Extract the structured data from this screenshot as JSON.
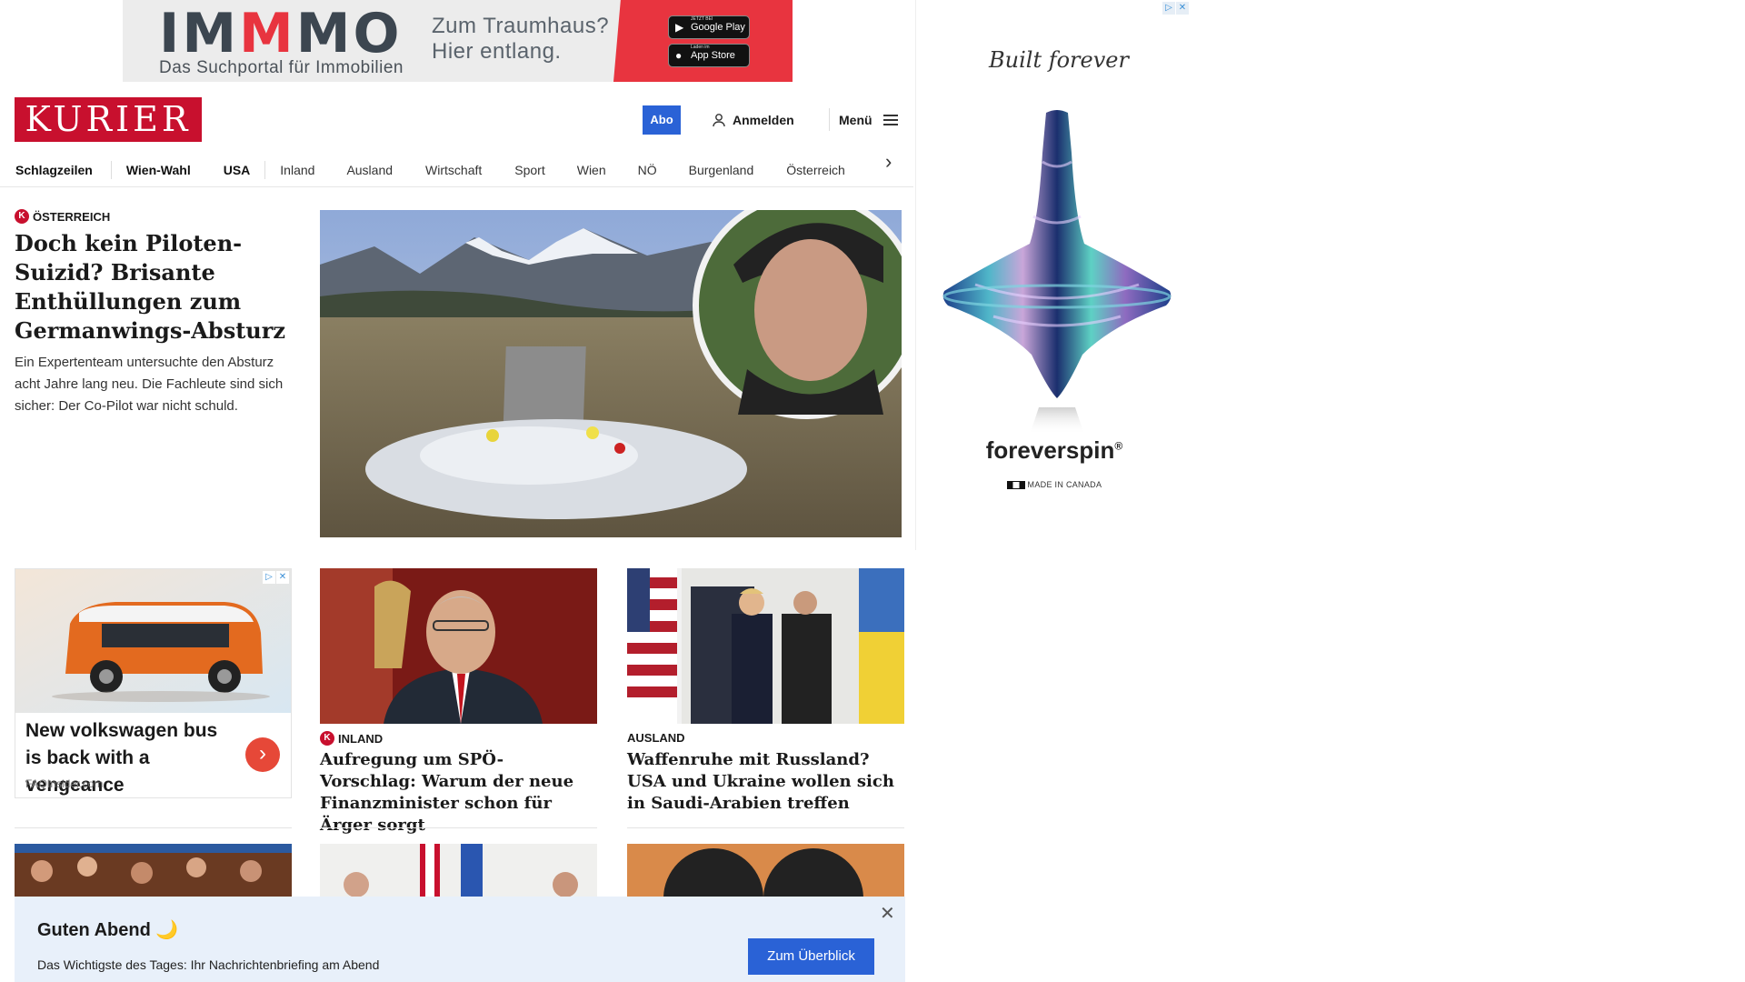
{
  "top_ad": {
    "brand_prefix": "IM",
    "brand_m": "M",
    "brand_suffix": "MO",
    "subtitle": "Das Suchportal für Immobilien",
    "slogan_line1": "Zum Traumhaus?",
    "slogan_line2": "Hier entlang.",
    "google_play_small": "JETZT BEI",
    "google_play": "Google Play",
    "app_store_small": "Laden im",
    "app_store": "App Store"
  },
  "header": {
    "logo": "KURIER",
    "abo": "Abo",
    "login": "Anmelden",
    "menu": "Menü"
  },
  "nav": {
    "items": [
      "Schlagzeilen",
      "Wien-Wahl",
      "USA",
      "Inland",
      "Ausland",
      "Wirtschaft",
      "Sport",
      "Wien",
      "NÖ",
      "Burgenland",
      "Österreich"
    ]
  },
  "side_ad": {
    "script": "Built forever",
    "brand": "foreverspin",
    "registered": "®",
    "made": "MADE IN CANADA"
  },
  "hero": {
    "kicker": "ÖSTERREICH",
    "badge": "K",
    "title": "Doch kein Piloten-Suizid? Brisante Enthüllungen zum Germanwings-Absturz",
    "teaser": "Ein Expertenteam untersuchte den Absturz acht Jahre lang neu. Die Fachleute sind sich sicher: Der Co-Pilot war nicht schuld."
  },
  "ad_card": {
    "title": "New volkswagen bus is back with a vengeance",
    "source": "FAQInsider.com"
  },
  "cards": [
    {
      "kicker": "INLAND",
      "badge": "K",
      "title": "Aufregung um SPÖ-Vorschlag: Warum der neue Finanzminister schon für Ärger sorgt"
    },
    {
      "kicker": "AUSLAND",
      "title": "Waffenruhe mit Russland? USA und Ukraine wollen sich in Saudi-Arabien treffen"
    }
  ],
  "briefing": {
    "greeting": "Guten Abend 🌙",
    "description": "Das Wichtigste des Tages: Ihr Nachrichtenbriefing am Abend",
    "cta": "Zum Überblick",
    "close": "✕"
  },
  "colors": {
    "brand_red": "#c8102e",
    "accent_blue": "#2a62d6",
    "briefing_bg": "#e8f0fa"
  }
}
